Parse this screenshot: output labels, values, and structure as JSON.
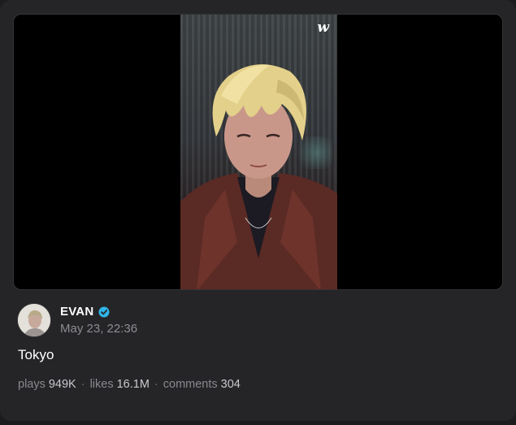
{
  "video": {
    "brand_mark": "w"
  },
  "post": {
    "author_name": "EVAN",
    "date": "May 23, 22:36",
    "caption": "Tokyo"
  },
  "stats": {
    "plays_label": "plays",
    "plays_value": "949K",
    "likes_label": "likes",
    "likes_value": "16.1M",
    "comments_label": "comments",
    "comments_value": "304",
    "separator": "·"
  },
  "colors": {
    "background": "#1c1c1f",
    "card": "#252528",
    "verified_badge": "#2fb5e8",
    "muted_text": "#8c8c92"
  }
}
